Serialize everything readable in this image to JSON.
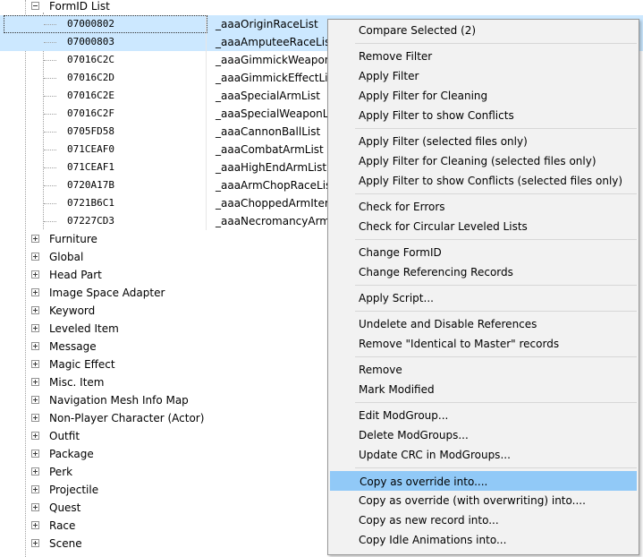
{
  "tree": {
    "formid_list_label": "FormID List",
    "records": [
      {
        "id": "07000802",
        "name": "_aaaOriginRaceList"
      },
      {
        "id": "07000803",
        "name": "_aaaAmputeeRaceList"
      },
      {
        "id": "07016C2C",
        "name": "_aaaGimmickWeaponLis"
      },
      {
        "id": "07016C2D",
        "name": "_aaaGimmickEffectList"
      },
      {
        "id": "07016C2E",
        "name": "_aaaSpecialArmList"
      },
      {
        "id": "07016C2F",
        "name": "_aaaSpecialWeaponList"
      },
      {
        "id": "0705FD58",
        "name": "_aaaCannonBallList"
      },
      {
        "id": "071CEAF0",
        "name": "_aaaCombatArmList"
      },
      {
        "id": "071CEAF1",
        "name": "_aaaHighEndArmList"
      },
      {
        "id": "0720A17B",
        "name": "_aaaArmChopRaceList"
      },
      {
        "id": "0721B6C1",
        "name": "_aaaChoppedArmItemL"
      },
      {
        "id": "07227CD3",
        "name": "_aaaNecromancyArmLi"
      }
    ],
    "categories": [
      "Furniture",
      "Global",
      "Head Part",
      "Image Space Adapter",
      "Keyword",
      "Leveled Item",
      "Message",
      "Magic Effect",
      "Misc. Item",
      "Navigation Mesh Info Map",
      "Non-Player Character (Actor)",
      "Outfit",
      "Package",
      "Perk",
      "Projectile",
      "Quest",
      "Race",
      "Scene"
    ]
  },
  "context_menu": {
    "groups": [
      [
        "Compare Selected (2)"
      ],
      [
        "Remove Filter",
        "Apply Filter",
        "Apply Filter for Cleaning",
        "Apply Filter to show Conflicts"
      ],
      [
        "Apply Filter (selected files only)",
        "Apply Filter for Cleaning (selected files only)",
        "Apply Filter to show Conflicts (selected files only)"
      ],
      [
        "Check for Errors",
        "Check for Circular Leveled Lists"
      ],
      [
        "Change FormID",
        "Change Referencing Records"
      ],
      [
        "Apply Script..."
      ],
      [
        "Undelete and Disable References",
        "Remove \"Identical to Master\" records"
      ],
      [
        "Remove",
        "Mark Modified"
      ],
      [
        "Edit ModGroup...",
        "Delete ModGroups...",
        "Update CRC in ModGroups..."
      ],
      [
        "Copy as override into....",
        "Copy as override (with overwriting) into....",
        "Copy as new record into...",
        "Copy Idle Animations into..."
      ]
    ],
    "highlighted": "Copy as override into...."
  },
  "colors": {
    "selection": "#cce8ff",
    "menu_background": "#f2f2f2",
    "menu_highlight": "#91c9f7"
  }
}
